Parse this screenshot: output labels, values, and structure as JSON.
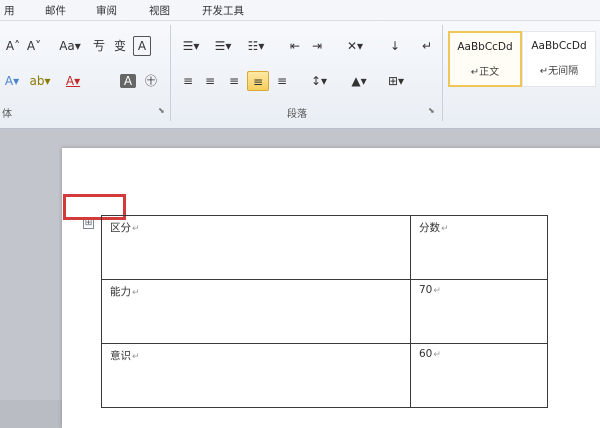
{
  "menu": [
    "用",
    "邮件",
    "审阅",
    "视图",
    "开发工具"
  ],
  "ribbon": {
    "font_row1": [
      "A˄",
      "A˅",
      "Aa▾",
      "亐",
      "变",
      "A"
    ],
    "font_row2": [
      "A▾",
      "ab▾",
      "A▾",
      "A",
      "㊉"
    ],
    "para_row1": [
      "☰▾",
      "☰▾",
      "☷▾",
      "⇤",
      "⇥",
      "✕▾",
      "↓",
      "↵"
    ],
    "para_row2": [
      "≡",
      "≡",
      "≡",
      "≡",
      "≡",
      "↕▾",
      "▲▾",
      "⊞▾"
    ],
    "group_font_label": "体",
    "group_para_label": "段落",
    "styles": [
      {
        "sample": "AaBbCcDd",
        "name": "↵正文"
      },
      {
        "sample": "AaBbCcDd",
        "name": "↵无间隔"
      }
    ]
  },
  "table": {
    "handle_icon": "⊞",
    "rows": [
      [
        "区分",
        "分数"
      ],
      [
        "能力",
        "70"
      ],
      [
        "意识",
        "60"
      ]
    ],
    "cell_mark": "↵"
  }
}
